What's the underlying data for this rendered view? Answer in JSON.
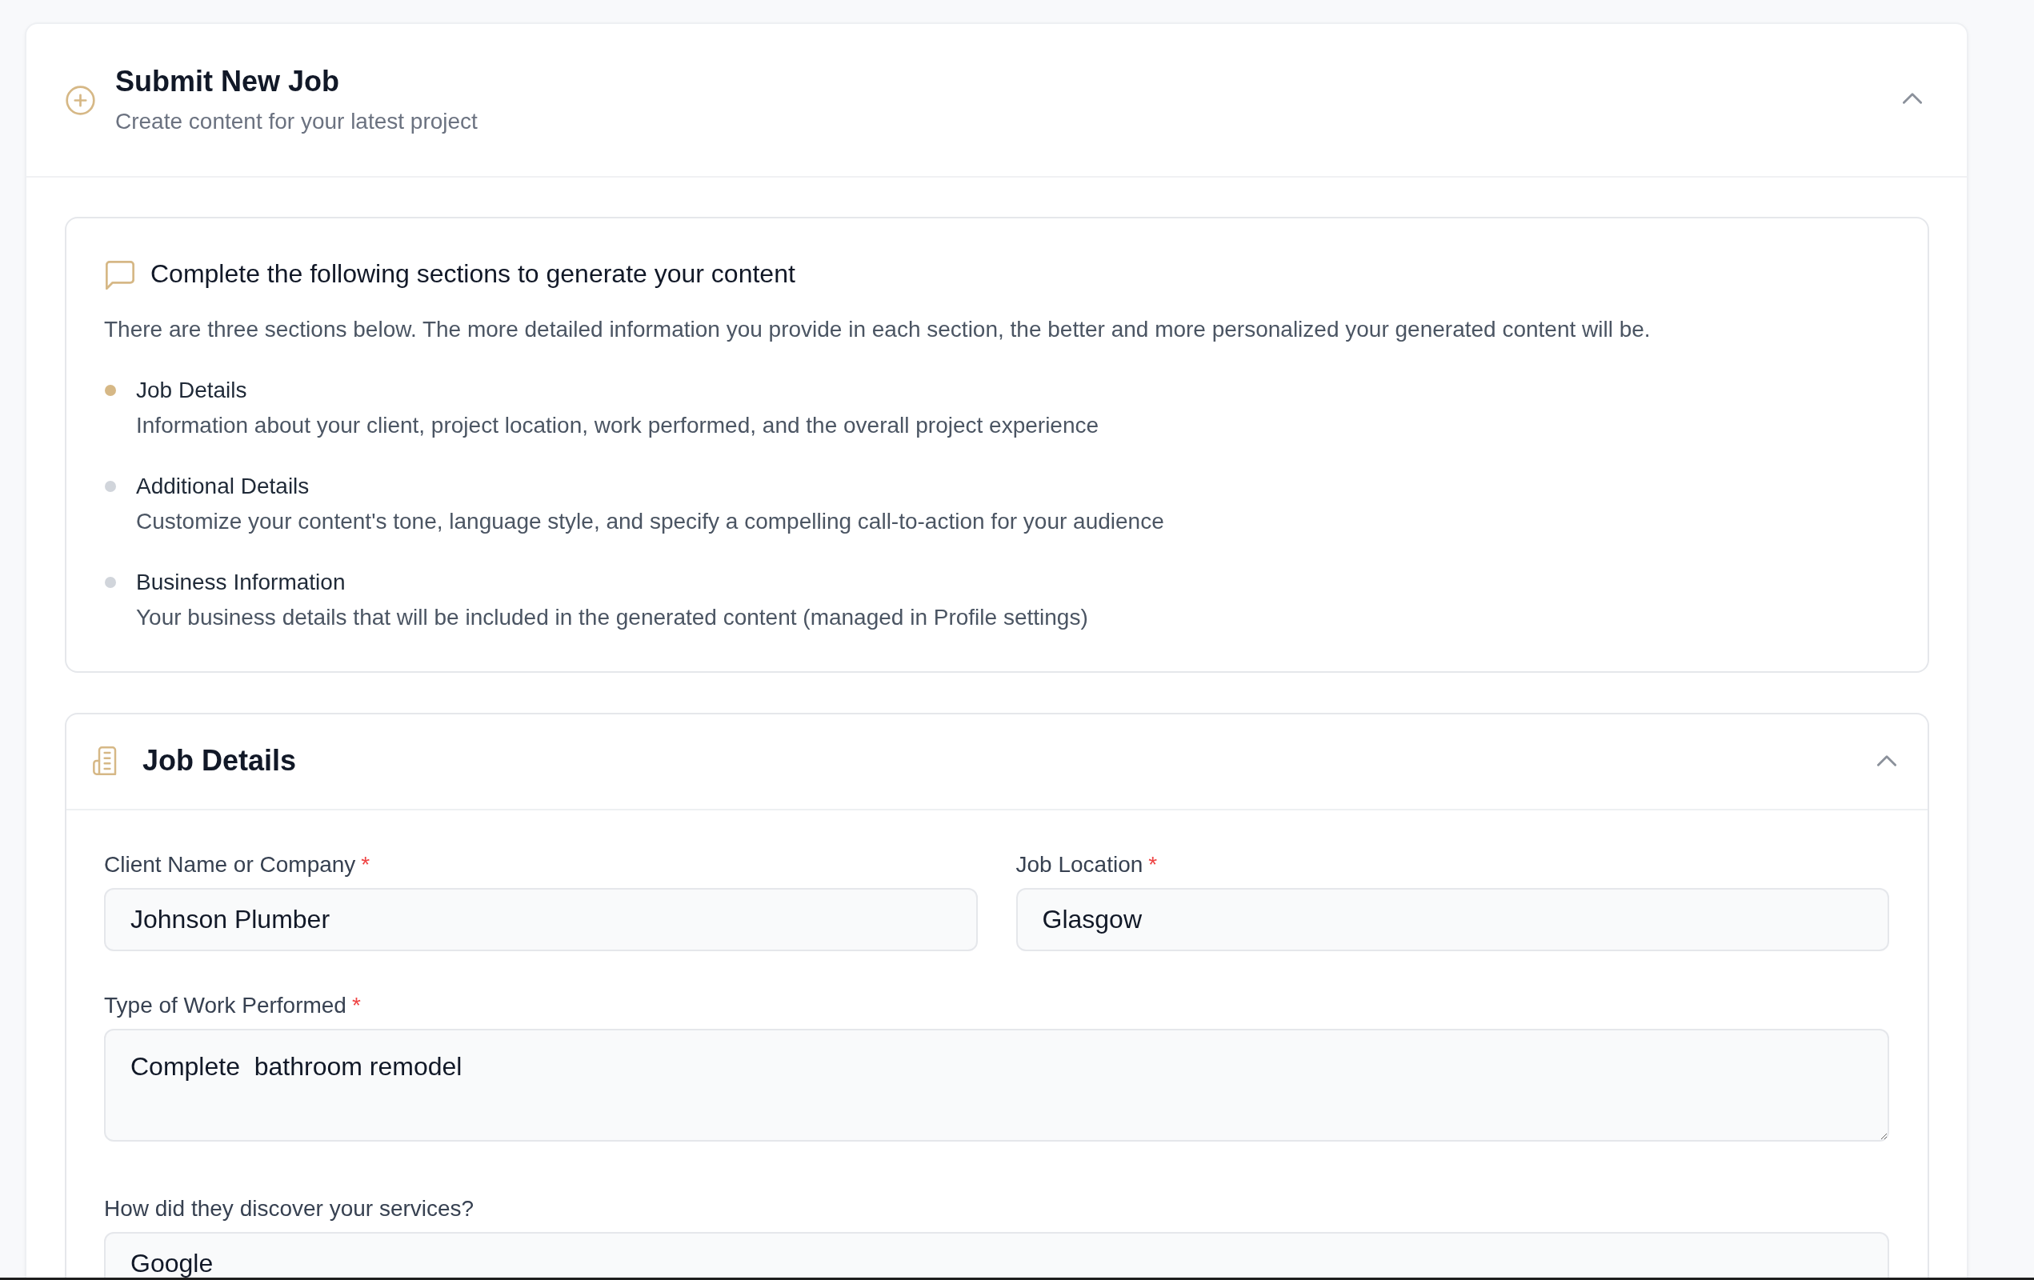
{
  "header": {
    "title": "Submit New Job",
    "subtitle": "Create content for your latest project",
    "expanded": true
  },
  "intro": {
    "heading": "Complete the following sections to generate your content",
    "description": "There are three sections below. The more detailed information you provide in each section, the better and more personalized your generated content will be.",
    "sections": [
      {
        "title": "Job Details",
        "description": "Information about your client, project location, work performed, and the overall project experience",
        "active": true
      },
      {
        "title": "Additional Details",
        "description": "Customize your content's tone, language style, and specify a compelling call-to-action for your audience",
        "active": false
      },
      {
        "title": "Business Information",
        "description": "Your business details that will be included in the generated content (managed in Profile settings)",
        "active": false
      }
    ]
  },
  "job_details": {
    "title": "Job Details",
    "expanded": true,
    "rows": [
      {
        "fields": [
          {
            "kind": "text",
            "label": "Client Name or Company",
            "required_mark": "*",
            "value": "Johnson Plumber"
          },
          {
            "kind": "text",
            "label": "Job Location",
            "required_mark": "*",
            "value": "Glasgow"
          }
        ]
      },
      {
        "fields": [
          {
            "kind": "textarea",
            "label": "Type of Work Performed",
            "required_mark": "*",
            "value": "Complete  bathroom remodel"
          }
        ]
      },
      {
        "fields": [
          {
            "kind": "text",
            "label": "How did they discover your services?",
            "value": "Google"
          }
        ]
      }
    ]
  }
}
